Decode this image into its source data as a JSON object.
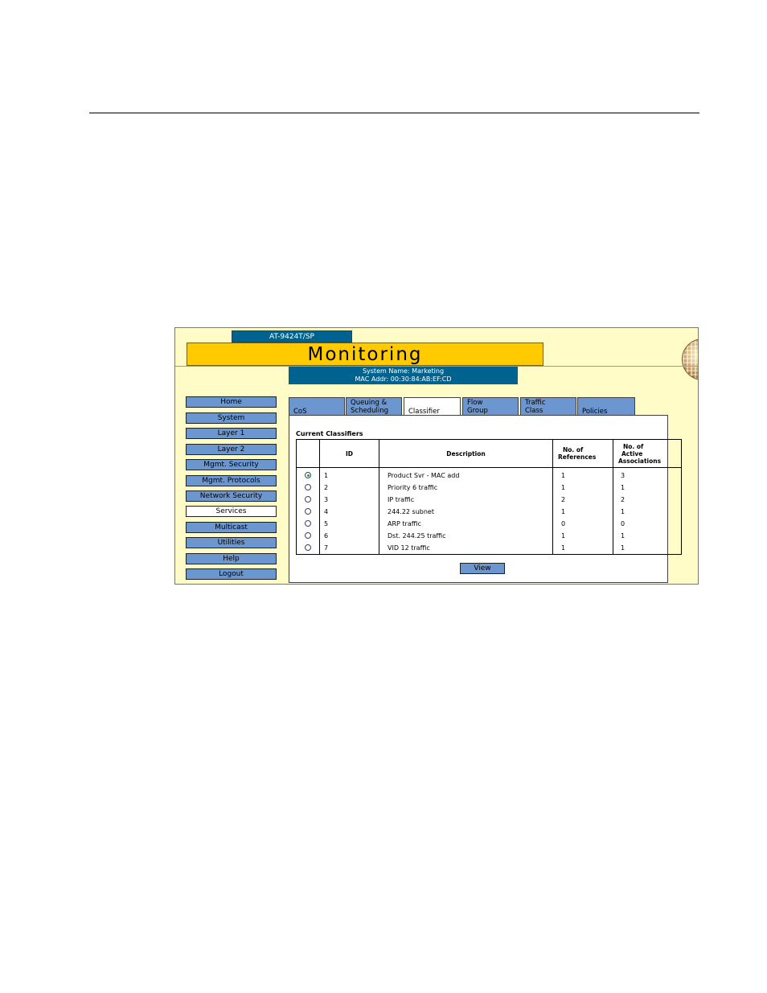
{
  "app": {
    "model": "AT-9424T/SP",
    "title": "Monitoring",
    "system_name_line": "System Name: Marketing",
    "mac_line": "MAC Addr: 00:30:84:AB:EF:CD"
  },
  "nav": {
    "items": [
      {
        "label": "Home"
      },
      {
        "label": "System"
      },
      {
        "label": "Layer 1"
      },
      {
        "label": "Layer 2"
      },
      {
        "label": "Mgmt. Security"
      },
      {
        "label": "Mgmt. Protocols"
      },
      {
        "label": "Network Security"
      },
      {
        "label": "Services",
        "active": true
      },
      {
        "label": "Multicast"
      },
      {
        "label": "Utilities"
      },
      {
        "label": "Help"
      },
      {
        "label": "Logout"
      }
    ]
  },
  "tabs": [
    {
      "line1": "",
      "line2": "CoS"
    },
    {
      "line1": "Queuing &",
      "line2": "Scheduling"
    },
    {
      "line1": "",
      "line2": "Classifier",
      "active": true
    },
    {
      "line1": "Flow",
      "line2": "Group"
    },
    {
      "line1": "Traffic",
      "line2": "Class"
    },
    {
      "line1": "",
      "line2": "Policies"
    }
  ],
  "section_title": "Current Classifiers",
  "table": {
    "headers": {
      "id": "ID",
      "description": "Description",
      "refs_line1": "No. of",
      "refs_line2": "References",
      "active_line1": "No. of",
      "active_line2": "Active",
      "active_line3": "Associations"
    },
    "rows": [
      {
        "id": "1",
        "description": "Product Svr - MAC add",
        "references": "1",
        "active": "3",
        "selected": true
      },
      {
        "id": "2",
        "description": "Priority 6 traffic",
        "references": "1",
        "active": "1"
      },
      {
        "id": "3",
        "description": "IP traffic",
        "references": "2",
        "active": "2"
      },
      {
        "id": "4",
        "description": "244.22 subnet",
        "references": "1",
        "active": "1"
      },
      {
        "id": "5",
        "description": "ARP traffic",
        "references": "0",
        "active": "0"
      },
      {
        "id": "6",
        "description": "Dst. 244.25 traffic",
        "references": "1",
        "active": "1"
      },
      {
        "id": "7",
        "description": "VID 12 traffic",
        "references": "1",
        "active": "1"
      }
    ]
  },
  "view_label": "View",
  "icons": {
    "logo": "globe-icon"
  },
  "colors": {
    "banner": "#ffcb00",
    "header_blue": "#00628f",
    "button_blue": "#6b96d0",
    "background": "#fffcc8"
  }
}
